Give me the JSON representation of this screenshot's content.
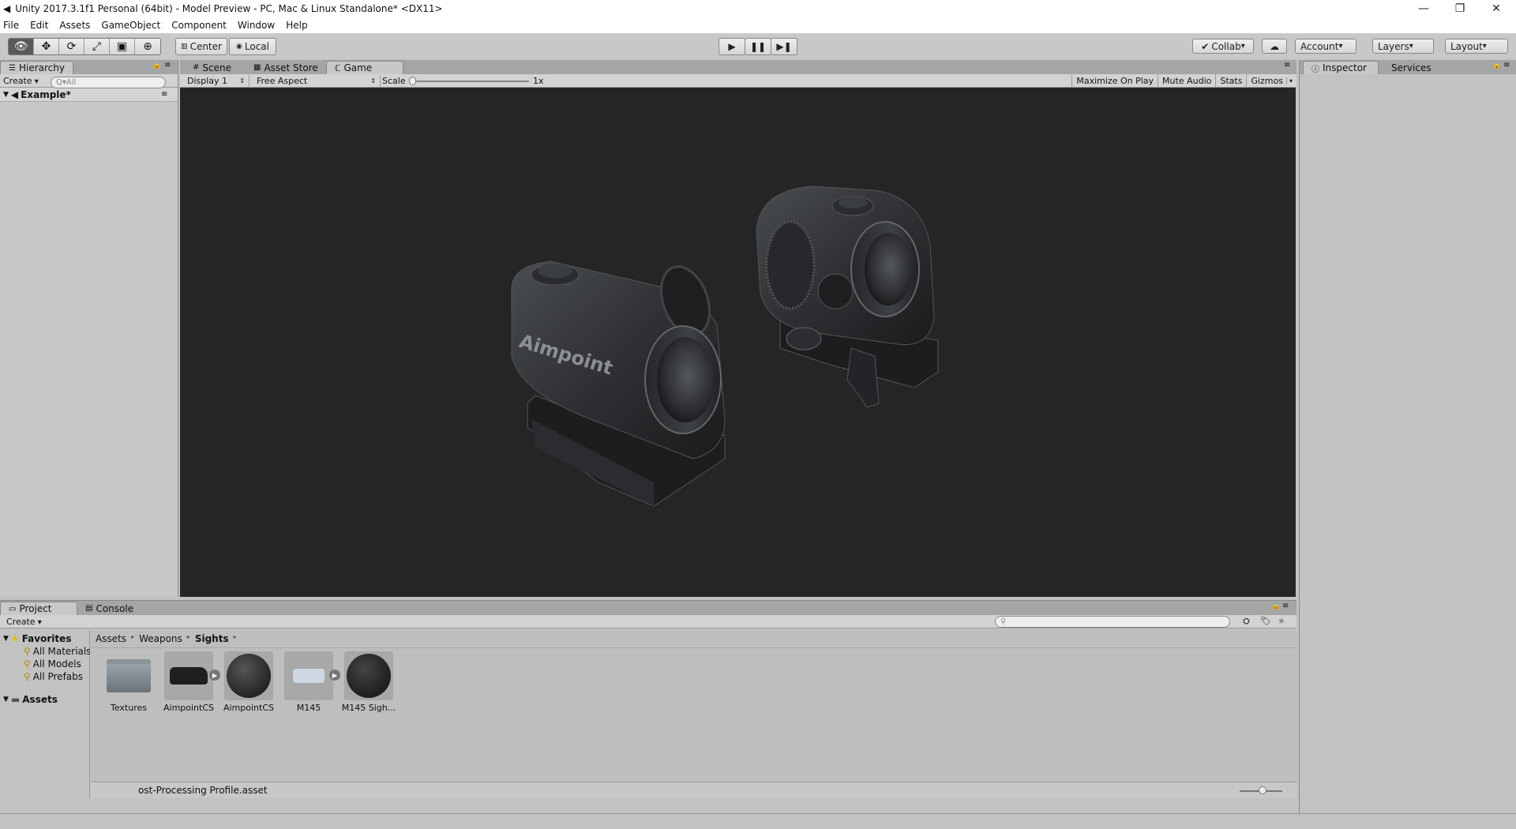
{
  "window": {
    "title": "Unity 2017.3.1f1 Personal (64bit) - Model Preview - PC, Mac & Linux Standalone* <DX11>",
    "minimize": "—",
    "restore": "❐",
    "close": "✕"
  },
  "menu": [
    "File",
    "Edit",
    "Assets",
    "GameObject",
    "Component",
    "Window",
    "Help"
  ],
  "toolbar": {
    "tools": [
      "view-tool",
      "move-tool",
      "rotate-tool",
      "scale-tool",
      "rect-tool",
      "transform-tool"
    ],
    "pivot": "Center",
    "space": "Local",
    "collab": "Collab",
    "account": "Account",
    "layers": "Layers",
    "layout": "Layout"
  },
  "hierarchy": {
    "tab": "Hierarchy",
    "create": "Create",
    "search_placeholder": "All",
    "scene": "Example*"
  },
  "center_tabs": [
    "Scene",
    "Asset Store",
    "Game"
  ],
  "game_bar": {
    "display": "Display 1",
    "aspect": "Free Aspect",
    "scale_label": "Scale",
    "scale_value": "1x",
    "maximize": "Maximize On Play",
    "mute": "Mute Audio",
    "stats": "Stats",
    "gizmos": "Gizmos"
  },
  "viewport": {
    "brand_text": "Aimpoint"
  },
  "inspector": {
    "tab": "Inspector",
    "services": "Services"
  },
  "project": {
    "tabs": [
      "Project",
      "Console"
    ],
    "create": "Create",
    "favorites": "Favorites",
    "favorite_items": [
      "All Materials",
      "All Models",
      "All Prefabs"
    ],
    "assets_root": "Assets",
    "breadcrumb": [
      "Assets",
      "Weapons",
      "Sights"
    ],
    "assets": [
      "Textures",
      "AimpointCS",
      "AimpointCS",
      "M145",
      "M145 Sigh..."
    ],
    "selected_path": "ost-Processing Profile.asset"
  },
  "colors": {
    "viewport_bg": "#252525",
    "panel_bg": "#c2c2c2",
    "toolbar_bg": "#c8c8c8"
  }
}
